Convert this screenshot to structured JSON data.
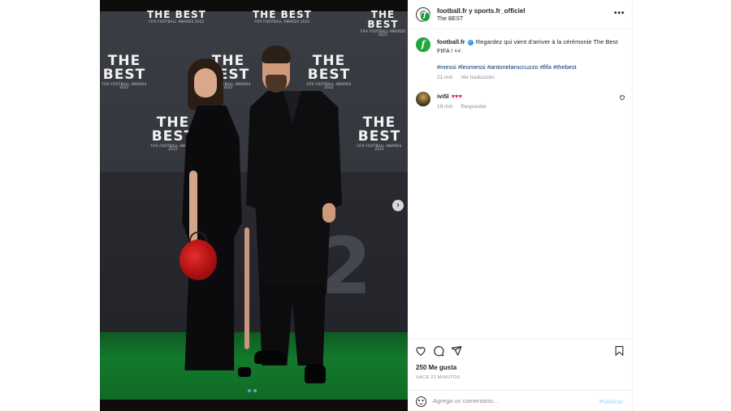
{
  "media": {
    "logo_big": "THE BEST",
    "logo_small": "FIFA FOOTBALL AWARDS 2022",
    "next_icon": "chevron-right-icon",
    "carousel_count": 2,
    "carousel_active_index": 0
  },
  "header": {
    "title": "football.fr y sports.fr_officiel",
    "subtitle": "The BEST",
    "more_icon": "more-options-icon",
    "more_label": "•••"
  },
  "caption": {
    "avatar_letter": "f",
    "username": "football.fr",
    "verified_icon": "verified-badge-icon",
    "text": "Regardez qui vient d'arriver à la cérémonie The Best FIFA ! 👀",
    "tags": "#messi #leomessi #antonelaroccuzzo #fifa #thebest",
    "time": "21 min",
    "translate_label": "Ver traducción"
  },
  "comment": {
    "username": "ivi5l",
    "text": "♥♥♥",
    "time": "19 min",
    "reply_label": "Responder",
    "like_icon": "heart-outline-icon"
  },
  "actions": {
    "like_icon": "heart-outline-icon",
    "comment_icon": "comment-bubble-icon",
    "share_icon": "paper-plane-icon",
    "save_icon": "bookmark-icon",
    "likes_text": "250 Me gusta",
    "posted_text": "HACE 22 MINUTOS"
  },
  "composer": {
    "emoji_icon": "emoji-smile-icon",
    "placeholder": "Agrega un comentario...",
    "publish_label": "Publicar"
  },
  "colors": {
    "link": "#00376b",
    "publish_disabled": "#b2dffc",
    "verified": "#3897f0",
    "brand_green": "#22a53c"
  }
}
